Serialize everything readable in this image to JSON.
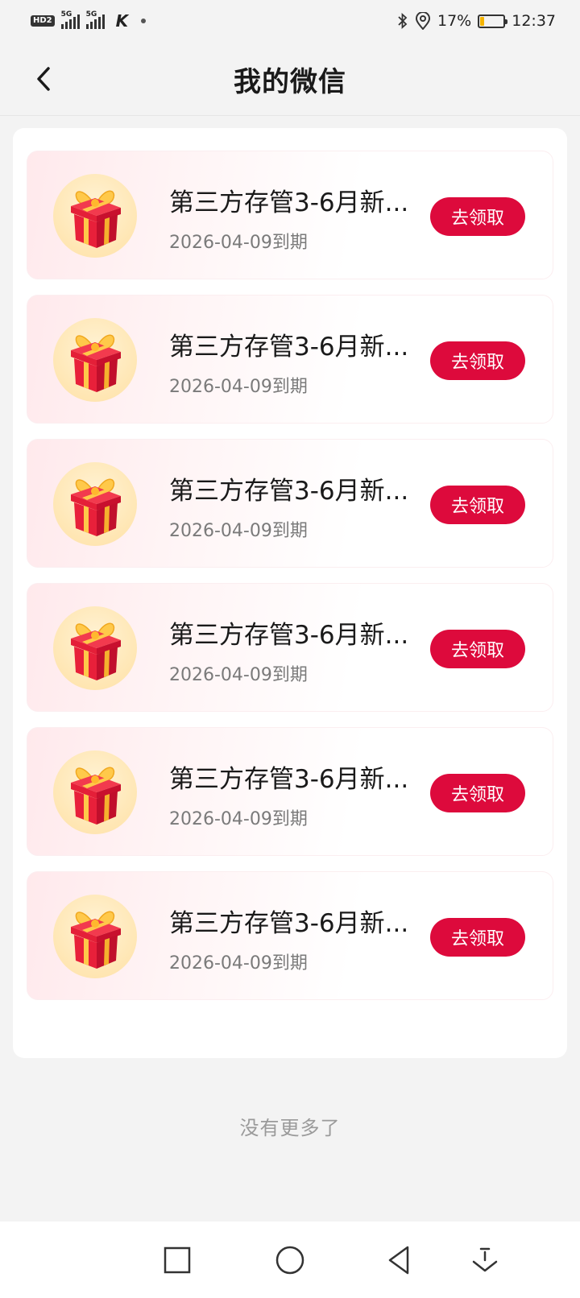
{
  "status_bar": {
    "network_badge": "HD2",
    "signal1_label": "5G",
    "signal2_label": "5G",
    "app_icon_letter": "K",
    "battery_percent": "17%",
    "battery_level": 0.17,
    "time": "12:37",
    "battery_color": "#f5b400"
  },
  "header": {
    "title": "我的微信",
    "back_icon": "chevron-left-icon"
  },
  "coupons": [
    {
      "title": "第三方存管3-6月新...",
      "date": "2026-04-09到期",
      "button": "去领取"
    },
    {
      "title": "第三方存管3-6月新...",
      "date": "2026-04-09到期",
      "button": "去领取"
    },
    {
      "title": "第三方存管3-6月新...",
      "date": "2026-04-09到期",
      "button": "去领取"
    },
    {
      "title": "第三方存管3-6月新...",
      "date": "2026-04-09到期",
      "button": "去领取"
    },
    {
      "title": "第三方存管3-6月新...",
      "date": "2026-04-09到期",
      "button": "去领取"
    },
    {
      "title": "第三方存管3-6月新...",
      "date": "2026-04-09到期",
      "button": "去领取"
    }
  ],
  "footer": {
    "no_more_text": "没有更多了"
  },
  "colors": {
    "accent": "#dd0a3c",
    "background": "#f3f3f3"
  },
  "nav_bar": {
    "icons": [
      "square-icon",
      "circle-icon",
      "triangle-back-icon",
      "down-arrow-icon"
    ]
  }
}
